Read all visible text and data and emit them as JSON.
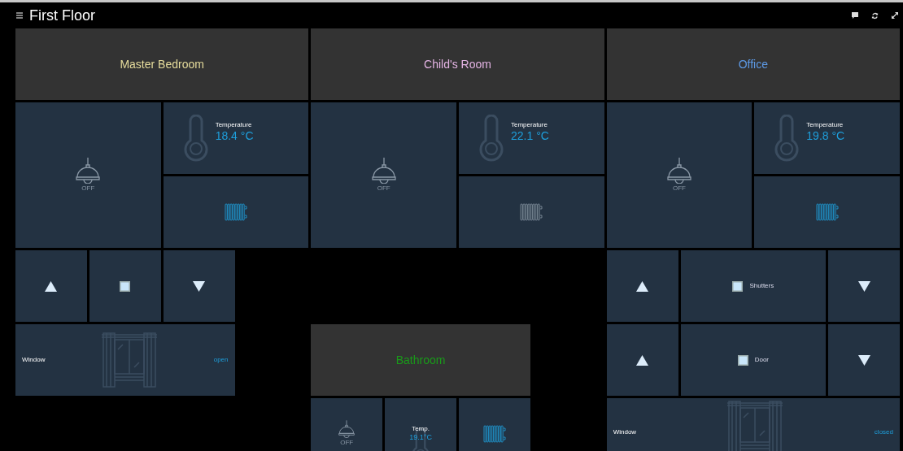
{
  "header": {
    "title": "First Floor"
  },
  "rooms": [
    {
      "name": "Master Bedroom",
      "color": "#e6dc9c",
      "tiles": [
        {
          "kind": "lamp",
          "status": "OFF"
        },
        {
          "kind": "temperature",
          "label": "Temperature",
          "value": "18.4 °C"
        },
        {
          "kind": "heater",
          "on": true
        },
        {
          "kind": "up"
        },
        {
          "kind": "stop"
        },
        {
          "kind": "down"
        },
        {
          "kind": "window",
          "label": "Window",
          "status": "open"
        }
      ]
    },
    {
      "name": "Child's Room",
      "color": "#e4b4e4",
      "tiles": [
        {
          "kind": "lamp",
          "status": "OFF"
        },
        {
          "kind": "temperature",
          "label": "Temperature",
          "value": "22.1 °C"
        },
        {
          "kind": "heater",
          "on": false
        }
      ]
    },
    {
      "name": "Office",
      "color": "#5d9ae6",
      "tiles": [
        {
          "kind": "lamp",
          "status": "OFF"
        },
        {
          "kind": "temperature",
          "label": "Temperature",
          "value": "19.8 °C"
        },
        {
          "kind": "heater",
          "on": true
        },
        {
          "kind": "up"
        },
        {
          "kind": "stop",
          "label": "Shutters"
        },
        {
          "kind": "down"
        },
        {
          "kind": "up"
        },
        {
          "kind": "stop",
          "label": "Door"
        },
        {
          "kind": "down"
        },
        {
          "kind": "window",
          "label": "Window",
          "status": "closed"
        }
      ]
    },
    {
      "name": "Bathroom",
      "color": "#1a9a1a",
      "tiles": [
        {
          "kind": "lamp",
          "status": "OFF"
        },
        {
          "kind": "temperature",
          "label": "Temp.",
          "value": "19.1°C"
        },
        {
          "kind": "heater",
          "on": true
        }
      ]
    }
  ]
}
